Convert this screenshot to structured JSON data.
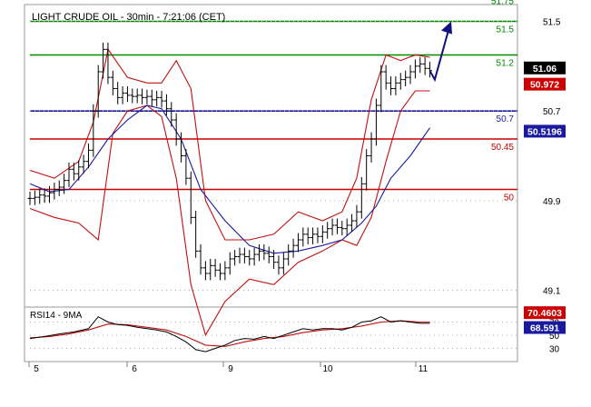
{
  "chart_data": [
    {
      "type": "line",
      "title": "LIGHT CRUDE OIL - 30min - 7:21:06 (CET)",
      "ylim": [
        48.95,
        51.65
      ],
      "x_labels": [
        "5",
        "6",
        "9",
        "10",
        "11"
      ],
      "y_ticks": [
        49.1,
        49.9,
        50.7,
        51.5
      ],
      "y_tick_labels": [
        "49.1",
        "49.9",
        "50.7",
        "51.5"
      ],
      "grid": false,
      "levels": [
        {
          "value": 51.75,
          "label": "51.75",
          "color": "#008800"
        },
        {
          "value": 51.5,
          "label": "51.5",
          "color": "#008800"
        },
        {
          "value": 51.2,
          "label": "51.2",
          "color": "#008800"
        },
        {
          "value": 50.7,
          "label": "50.7",
          "color": "#1a1aa0"
        },
        {
          "value": 50.45,
          "label": "50.45",
          "color": "#cc0000"
        },
        {
          "value": 50.0,
          "label": "50",
          "color": "#cc0000"
        }
      ],
      "badges": [
        {
          "label": "51.06",
          "value": 51.06,
          "bg": "#000000"
        },
        {
          "label": "50.972",
          "value": 50.972,
          "bg": "#cc0000"
        },
        {
          "label": "50.5196",
          "value": 50.5196,
          "bg": "#1a1aa0"
        }
      ],
      "price_series": [
        [
          0,
          49.92
        ],
        [
          1,
          49.93
        ],
        [
          2,
          49.95
        ],
        [
          3,
          49.94
        ],
        [
          4,
          49.97
        ],
        [
          5,
          50.0
        ],
        [
          6,
          50.02
        ],
        [
          7,
          50.08
        ],
        [
          8,
          50.18
        ],
        [
          9,
          50.14
        ],
        [
          10,
          50.2
        ],
        [
          11,
          50.25
        ],
        [
          12,
          50.35
        ],
        [
          13,
          50.7
        ],
        [
          14,
          51.05
        ],
        [
          15,
          51.25
        ],
        [
          16,
          51.0
        ],
        [
          17,
          50.9
        ],
        [
          18,
          50.82
        ],
        [
          19,
          50.86
        ],
        [
          20,
          50.84
        ],
        [
          21,
          50.83
        ],
        [
          22,
          50.84
        ],
        [
          23,
          50.82
        ],
        [
          24,
          50.83
        ],
        [
          25,
          50.8
        ],
        [
          26,
          50.82
        ],
        [
          27,
          50.79
        ],
        [
          28,
          50.72
        ],
        [
          29,
          50.62
        ],
        [
          30,
          50.45
        ],
        [
          31,
          50.3
        ],
        [
          32,
          50.1
        ],
        [
          33,
          49.75
        ],
        [
          34,
          49.45
        ],
        [
          35,
          49.3
        ],
        [
          36,
          49.25
        ],
        [
          37,
          49.32
        ],
        [
          38,
          49.28
        ],
        [
          39,
          49.25
        ],
        [
          40,
          49.3
        ],
        [
          41,
          49.38
        ],
        [
          42,
          49.4
        ],
        [
          43,
          49.42
        ],
        [
          44,
          49.4
        ],
        [
          45,
          49.38
        ],
        [
          46,
          49.42
        ],
        [
          47,
          49.45
        ],
        [
          48,
          49.43
        ],
        [
          49,
          49.4
        ],
        [
          50,
          49.35
        ],
        [
          51,
          49.3
        ],
        [
          52,
          49.38
        ],
        [
          53,
          49.45
        ],
        [
          54,
          49.5
        ],
        [
          55,
          49.55
        ],
        [
          56,
          49.6
        ],
        [
          57,
          49.57
        ],
        [
          58,
          49.6
        ],
        [
          59,
          49.58
        ],
        [
          60,
          49.62
        ],
        [
          61,
          49.65
        ],
        [
          62,
          49.68
        ],
        [
          63,
          49.66
        ],
        [
          64,
          49.65
        ],
        [
          65,
          49.68
        ],
        [
          66,
          49.72
        ],
        [
          67,
          49.8
        ],
        [
          68,
          50.05
        ],
        [
          69,
          50.3
        ],
        [
          70,
          50.45
        ],
        [
          71,
          50.75
        ],
        [
          72,
          51.05
        ],
        [
          73,
          50.95
        ],
        [
          74,
          50.9
        ],
        [
          75,
          50.95
        ],
        [
          76,
          50.98
        ],
        [
          77,
          51.0
        ],
        [
          78,
          51.05
        ],
        [
          79,
          51.1
        ],
        [
          80,
          51.12
        ],
        [
          81,
          51.08
        ],
        [
          82,
          51.06
        ]
      ],
      "bollinger_upper": [
        [
          0,
          50.17
        ],
        [
          5,
          50.1
        ],
        [
          10,
          50.25
        ],
        [
          13,
          50.6
        ],
        [
          16,
          51.25
        ],
        [
          20,
          51.0
        ],
        [
          24,
          50.95
        ],
        [
          27,
          50.95
        ],
        [
          30,
          51.15
        ],
        [
          33,
          50.9
        ],
        [
          36,
          49.9
        ],
        [
          40,
          49.55
        ],
        [
          45,
          49.55
        ],
        [
          50,
          49.6
        ],
        [
          55,
          49.8
        ],
        [
          60,
          49.72
        ],
        [
          64,
          49.8
        ],
        [
          67,
          50.1
        ],
        [
          70,
          50.8
        ],
        [
          73,
          51.2
        ],
        [
          76,
          51.15
        ],
        [
          79,
          51.2
        ],
        [
          82,
          51.18
        ]
      ],
      "bollinger_lower": [
        [
          0,
          49.83
        ],
        [
          5,
          49.75
        ],
        [
          10,
          49.7
        ],
        [
          14,
          49.55
        ],
        [
          17,
          50.5
        ],
        [
          20,
          50.7
        ],
        [
          24,
          50.75
        ],
        [
          27,
          50.65
        ],
        [
          30,
          50.1
        ],
        [
          33,
          49.15
        ],
        [
          36,
          48.7
        ],
        [
          40,
          49.0
        ],
        [
          45,
          49.2
        ],
        [
          50,
          49.15
        ],
        [
          55,
          49.35
        ],
        [
          60,
          49.45
        ],
        [
          64,
          49.55
        ],
        [
          67,
          49.5
        ],
        [
          70,
          49.75
        ],
        [
          73,
          50.25
        ],
        [
          76,
          50.7
        ],
        [
          79,
          50.88
        ],
        [
          82,
          50.88
        ]
      ],
      "moving_average": [
        [
          0,
          50.05
        ],
        [
          4,
          49.98
        ],
        [
          8,
          50.0
        ],
        [
          12,
          50.2
        ],
        [
          16,
          50.45
        ],
        [
          20,
          50.62
        ],
        [
          24,
          50.75
        ],
        [
          27,
          50.72
        ],
        [
          31,
          50.45
        ],
        [
          35,
          50.0
        ],
        [
          40,
          49.72
        ],
        [
          45,
          49.5
        ],
        [
          50,
          49.43
        ],
        [
          55,
          49.45
        ],
        [
          60,
          49.5
        ],
        [
          64,
          49.55
        ],
        [
          68,
          49.7
        ],
        [
          71,
          49.85
        ],
        [
          74,
          50.1
        ],
        [
          78,
          50.3
        ],
        [
          82,
          50.55
        ]
      ],
      "projection": [
        [
          82,
          51.06
        ],
        [
          83,
          50.98
        ],
        [
          86,
          51.45
        ]
      ]
    },
    {
      "type": "line",
      "title": "RSI14 - 9MA",
      "ylim": [
        10,
        90
      ],
      "y_ticks": [
        30,
        50,
        70
      ],
      "y_tick_labels": [
        "30",
        "50",
        "70"
      ],
      "badges": [
        {
          "label": "70.4603",
          "value": 70.4603,
          "bg": "#cc0000"
        },
        {
          "label": "68.591",
          "value": 68.591,
          "bg": "#1a1aa0"
        }
      ],
      "rsi_series": [
        [
          0,
          45
        ],
        [
          3,
          48
        ],
        [
          6,
          52
        ],
        [
          9,
          55
        ],
        [
          12,
          60
        ],
        [
          14,
          78
        ],
        [
          16,
          70
        ],
        [
          18,
          66
        ],
        [
          20,
          65
        ],
        [
          22,
          62
        ],
        [
          24,
          60
        ],
        [
          26,
          58
        ],
        [
          28,
          55
        ],
        [
          30,
          48
        ],
        [
          32,
          40
        ],
        [
          34,
          28
        ],
        [
          36,
          25
        ],
        [
          38,
          30
        ],
        [
          40,
          35
        ],
        [
          42,
          42
        ],
        [
          44,
          45
        ],
        [
          46,
          44
        ],
        [
          48,
          48
        ],
        [
          50,
          45
        ],
        [
          52,
          50
        ],
        [
          54,
          55
        ],
        [
          56,
          60
        ],
        [
          58,
          58
        ],
        [
          60,
          60
        ],
        [
          62,
          60
        ],
        [
          64,
          58
        ],
        [
          66,
          62
        ],
        [
          68,
          70
        ],
        [
          70,
          72
        ],
        [
          72,
          78
        ],
        [
          74,
          70
        ],
        [
          76,
          72
        ],
        [
          78,
          70
        ],
        [
          80,
          68
        ],
        [
          82,
          68
        ]
      ],
      "rsi_ma_series": [
        [
          0,
          46
        ],
        [
          4,
          48
        ],
        [
          8,
          52
        ],
        [
          12,
          58
        ],
        [
          16,
          67
        ],
        [
          20,
          66
        ],
        [
          24,
          62
        ],
        [
          28,
          58
        ],
        [
          32,
          48
        ],
        [
          36,
          35
        ],
        [
          40,
          33
        ],
        [
          44,
          40
        ],
        [
          48,
          45
        ],
        [
          52,
          48
        ],
        [
          56,
          54
        ],
        [
          60,
          58
        ],
        [
          64,
          60
        ],
        [
          68,
          64
        ],
        [
          72,
          70
        ],
        [
          76,
          72
        ],
        [
          80,
          70
        ],
        [
          82,
          70
        ]
      ]
    }
  ]
}
